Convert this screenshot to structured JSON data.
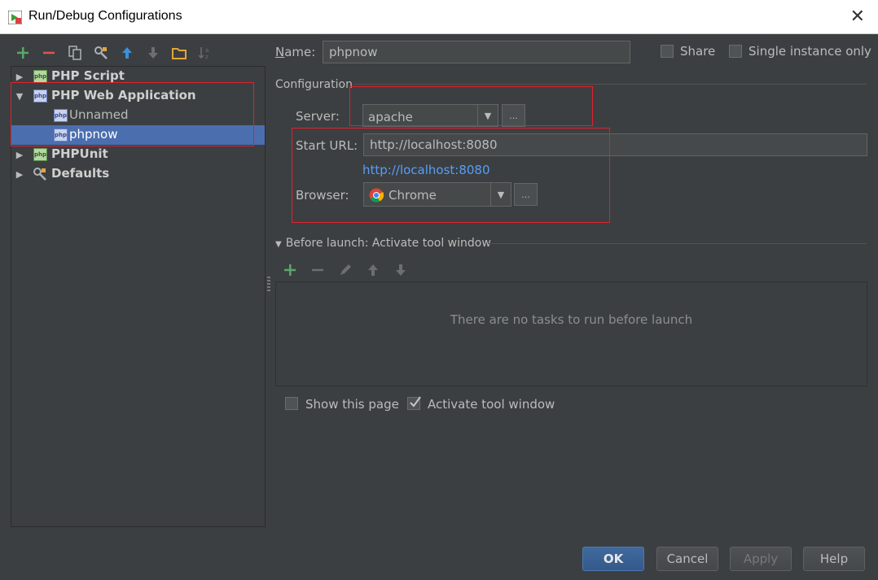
{
  "window": {
    "title": "Run/Debug Configurations"
  },
  "tree": {
    "items": [
      {
        "label": "PHP Script",
        "expanded": false
      },
      {
        "label": "PHP Web Application",
        "expanded": true
      },
      {
        "label": "Unnamed"
      },
      {
        "label": "phpnow",
        "selected": true
      },
      {
        "label": "PHPUnit",
        "expanded": false
      },
      {
        "label": "Defaults",
        "expanded": false
      }
    ],
    "icon_text": "php"
  },
  "form": {
    "name_label": "Name:",
    "name_value": "phpnow",
    "share_label": "Share",
    "single_instance_label": "Single instance only",
    "configuration_label": "Configuration",
    "server_label": "Server:",
    "server_value": "apache",
    "start_url_label": "Start URL:",
    "start_url_value": "http://localhost:8080",
    "start_url_link": "http://localhost:8080",
    "browser_label": "Browser:",
    "browser_value": "Chrome",
    "dots": "..."
  },
  "before_launch": {
    "title": "Before launch: Activate tool window",
    "empty_text": "There are no tasks to run before launch"
  },
  "options": {
    "show_page_label": "Show this page",
    "show_page_checked": false,
    "activate_tool_label": "Activate tool window",
    "activate_tool_checked": true
  },
  "buttons": {
    "ok": "OK",
    "cancel": "Cancel",
    "apply": "Apply",
    "help": "Help"
  },
  "colors": {
    "background": "#3c3f41",
    "selection": "#4b6eaf",
    "link": "#589df6",
    "highlight_box": "#e0212a",
    "add_green": "#59a869",
    "remove_red": "#e05555"
  }
}
